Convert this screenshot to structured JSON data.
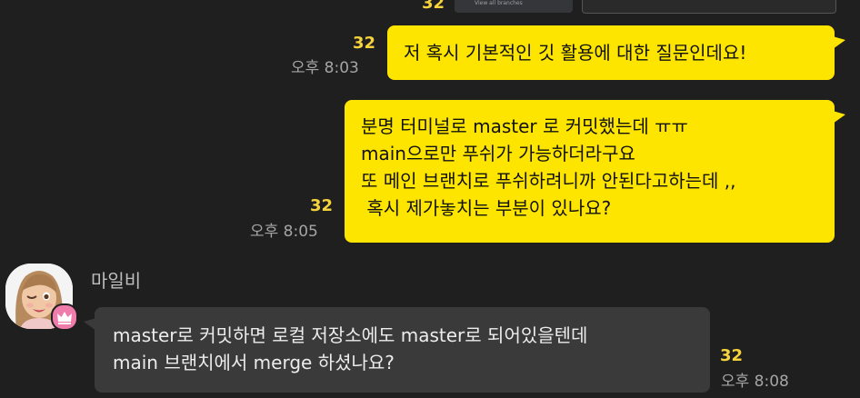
{
  "previous_attachment": {
    "unread_count": "32",
    "caption": "View all branches"
  },
  "messages": [
    {
      "sender": "me",
      "unread_count": "32",
      "time": "오후 8:03",
      "lines": [
        "저 혹시 기본적인 깃 활용에 대한 질문인데요!"
      ]
    },
    {
      "sender": "me",
      "unread_count": "32",
      "time": "오후 8:05",
      "lines": [
        "분명 터미널로 master 로 커밋했는데 ㅠㅠ",
        "main으로만 푸쉬가 가능하더라구요",
        "또 메인 브랜치로 푸쉬하려니까 안된다고하는데 ,,",
        " 혹시 제가놓치는 부분이 있나요?"
      ]
    },
    {
      "sender": "other",
      "name": "마일비",
      "avatar_icon": "memoji-avatar-icon",
      "badge_icon": "crown-icon",
      "unread_count": "32",
      "time": "오후 8:08",
      "lines": [
        "master로 커밋하면 로컬 저장소에도 master로 되어있을텐데",
        "main 브랜치에서 merge 하셨나요?"
      ]
    }
  ],
  "colors": {
    "background": "#1f1f1f",
    "my_bubble": "#fee500",
    "their_bubble": "#3a3a3a",
    "unread": "#f5d33c",
    "time": "#a5a5a5",
    "badge": "#f07cab"
  }
}
